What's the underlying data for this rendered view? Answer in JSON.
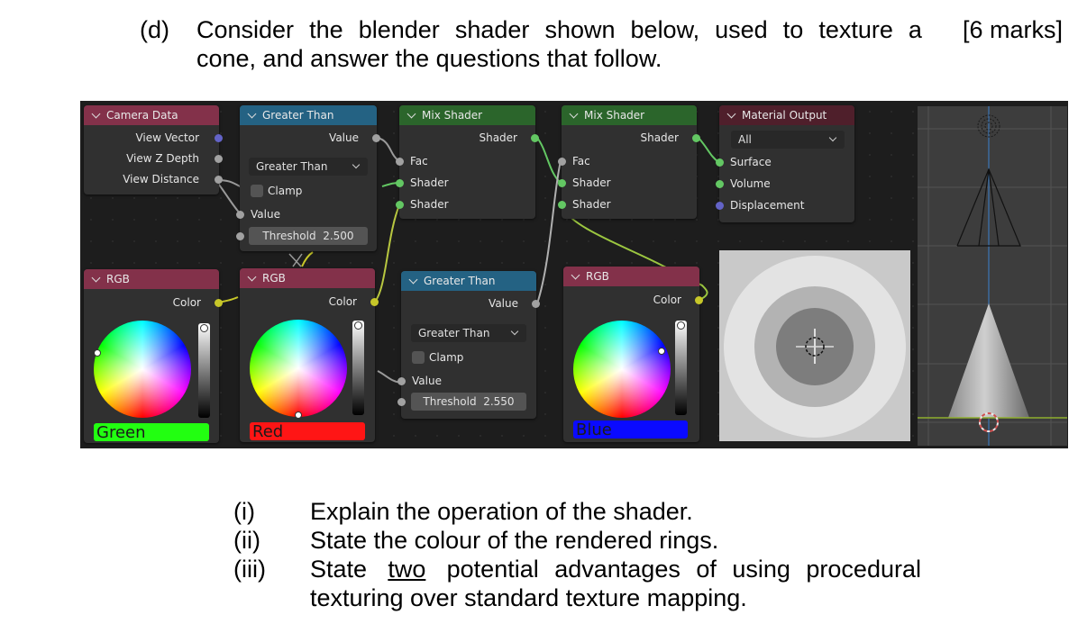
{
  "question": {
    "label": "(d)",
    "line1_words": [
      "Consider",
      "the",
      "blender",
      "shader",
      "shown",
      "below,",
      "used",
      "to",
      "texture",
      "a"
    ],
    "line2": "cone, and answer the questions that follow.",
    "marks": "[6 marks]"
  },
  "node_editor": {
    "camera_data": {
      "title": "Camera Data",
      "outputs": [
        "View Vector",
        "View Z Depth",
        "View Distance"
      ]
    },
    "greater_than_1": {
      "title": "Greater Than",
      "output": "Value",
      "operation": "Greater Than",
      "clamp_label": "Clamp",
      "clamp_checked": false,
      "input_value": "Value",
      "threshold_label": "Threshold",
      "threshold_value": "2.500"
    },
    "mix_shader_1": {
      "title": "Mix Shader",
      "output": "Shader",
      "inputs": [
        "Fac",
        "Shader",
        "Shader"
      ]
    },
    "mix_shader_2": {
      "title": "Mix Shader",
      "output": "Shader",
      "inputs": [
        "Fac",
        "Shader",
        "Shader"
      ]
    },
    "material_output": {
      "title": "Material Output",
      "target": "All",
      "inputs": [
        "Surface",
        "Volume",
        "Displacement"
      ]
    },
    "rgb_green": {
      "title": "RGB",
      "output": "Color",
      "swatch_label": "Green",
      "swatch_color": "#22ff11"
    },
    "rgb_red": {
      "title": "RGB",
      "output": "Color",
      "swatch_label": "Red",
      "swatch_color": "#ff1515"
    },
    "greater_than_2": {
      "title": "Greater Than",
      "output": "Value",
      "operation": "Greater Than",
      "clamp_label": "Clamp",
      "clamp_checked": false,
      "input_value": "Value",
      "threshold_label": "Threshold",
      "threshold_value": "2.550"
    },
    "rgb_blue": {
      "title": "RGB",
      "output": "Color",
      "swatch_label": "Blue",
      "swatch_color": "#0a0aff"
    }
  },
  "questions": [
    {
      "num": "(i)",
      "text": "Explain the operation of the shader."
    },
    {
      "num": "(ii)",
      "text": "State the colour of the rendered rings."
    },
    {
      "num": "(iii)",
      "text_before": "State",
      "underlined": "two",
      "text_after": "potential advantages of using procedural",
      "continuation": "texturing over standard texture mapping."
    }
  ]
}
